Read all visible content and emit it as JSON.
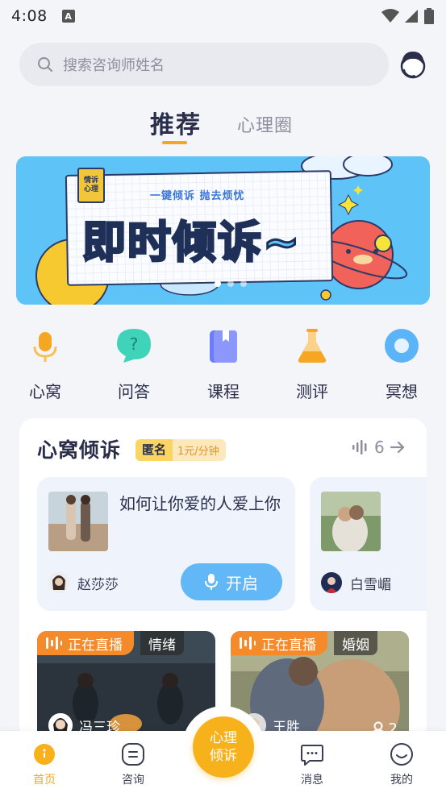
{
  "status_bar": {
    "time": "4:08",
    "notif_letter": "A"
  },
  "search": {
    "placeholder": "搜索咨询师姓名"
  },
  "tabs": [
    {
      "label": "推荐",
      "active": true
    },
    {
      "label": "心理圈",
      "active": false
    }
  ],
  "banner": {
    "tag_line1": "情诉",
    "tag_line2": "心理",
    "subtitle": "一键倾诉  抛去烦忧",
    "title": "即时倾诉~",
    "pages": 3,
    "active_page": 0
  },
  "quick_menu": [
    {
      "label": "心窝",
      "icon": "microphone-icon",
      "color": "#f5a623"
    },
    {
      "label": "问答",
      "icon": "question-bubble-icon",
      "color": "#3fd3b9"
    },
    {
      "label": "课程",
      "icon": "book-icon",
      "color": "#6b7cf6"
    },
    {
      "label": "测评",
      "icon": "flask-icon",
      "color": "#f5a623"
    },
    {
      "label": "冥想",
      "icon": "meditation-icon",
      "color": "#5bb4f7"
    }
  ],
  "section": {
    "title": "心窝倾诉",
    "badge_label": "匿名",
    "badge_price": "1元/分钟",
    "listener_count": "6"
  },
  "topic_cards": [
    {
      "title": "如何让你爱的人爱上你",
      "host": "赵莎莎",
      "button": "开启"
    },
    {
      "title": "",
      "host": "白雪嵋",
      "button": ""
    }
  ],
  "live_cards": [
    {
      "tag": "正在直播",
      "category": "情绪",
      "host": "冯三珍",
      "count": ""
    },
    {
      "tag": "正在直播",
      "category": "婚姻",
      "host": "王胜",
      "count": "2"
    }
  ],
  "bottom_nav": {
    "items": [
      {
        "label": "首页",
        "active": true
      },
      {
        "label": "咨询",
        "active": false
      },
      {
        "label": "消息",
        "active": false
      },
      {
        "label": "我的",
        "active": false
      }
    ],
    "center_line1": "心理",
    "center_line2": "倾诉"
  },
  "colors": {
    "accent": "#f5a623",
    "primary_blue": "#62b8f6",
    "text_dark": "#2a2e4a",
    "text_muted": "#8d8f9e"
  }
}
